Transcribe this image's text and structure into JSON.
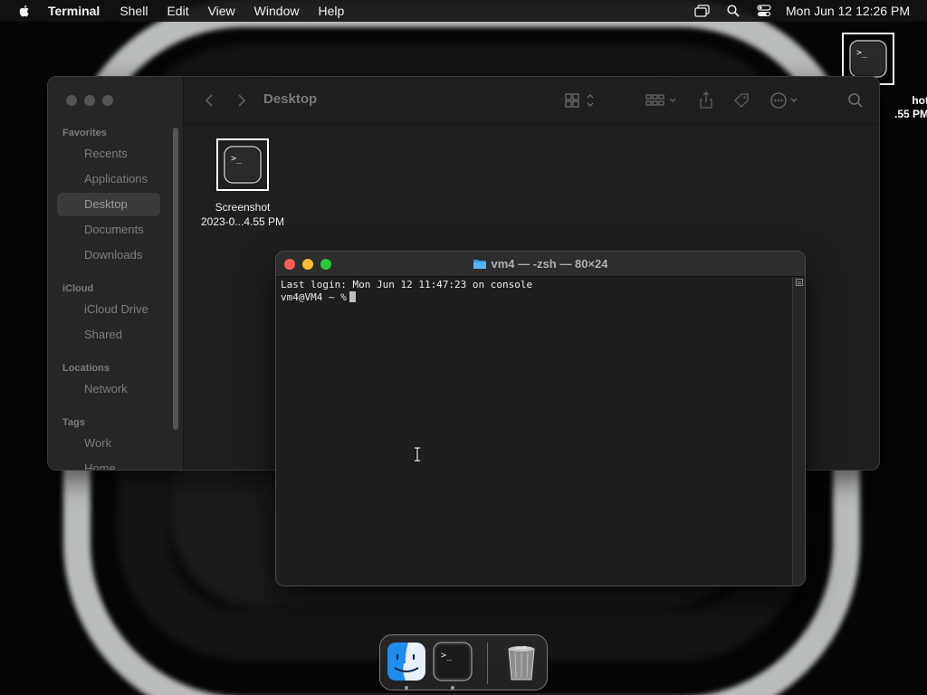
{
  "menubar": {
    "app_name": "Terminal",
    "items": [
      "Shell",
      "Edit",
      "View",
      "Window",
      "Help"
    ],
    "clock": "Mon Jun 12  12:26 PM"
  },
  "desktop_icon": {
    "label_line1": "hot",
    "label_line2": ".55 PM"
  },
  "finder": {
    "current_folder": "Desktop",
    "sidebar": {
      "favorites_header": "Favorites",
      "favorites": [
        "Recents",
        "Applications",
        "Desktop",
        "Documents",
        "Downloads"
      ],
      "icloud_header": "iCloud",
      "icloud": [
        "iCloud Drive",
        "Shared"
      ],
      "locations_header": "Locations",
      "locations": [
        "Network"
      ],
      "tags_header": "Tags",
      "tags": [
        "Work",
        "Home"
      ]
    },
    "file": {
      "name_line1": "Screenshot",
      "name_line2": "2023-0...4.55 PM"
    }
  },
  "terminal": {
    "title": "vm4 — -zsh — 80×24",
    "lines": [
      "Last login: Mon Jun 12 11:47:23 on console",
      "vm4@VM4 ~ %"
    ]
  },
  "dock": {
    "apps": [
      "finder-icon",
      "terminal-icon",
      "trash-icon"
    ]
  },
  "colors": {
    "close": "#ff5f57",
    "minimize": "#febc2e",
    "maximize": "#28c840"
  }
}
